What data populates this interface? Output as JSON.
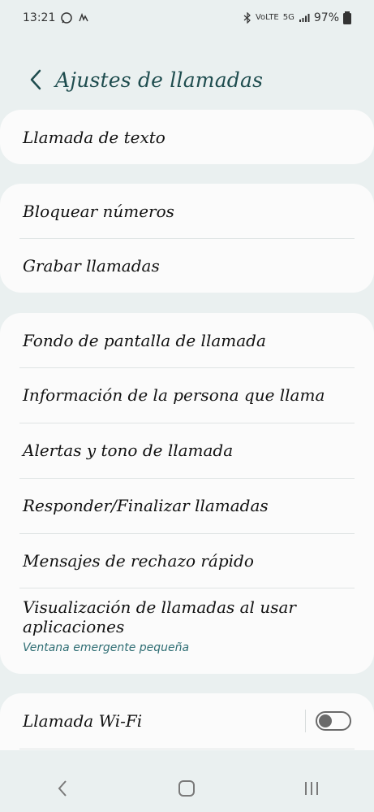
{
  "status_bar": {
    "time": "13:21",
    "battery_text": "97%",
    "network_badge": "5G",
    "volte_badge": "VoLTE",
    "icons": [
      "whatsapp-icon",
      "notification-icon",
      "bluetooth-icon",
      "volte-icon",
      "5g-icon",
      "signal-icon",
      "battery-icon"
    ]
  },
  "header": {
    "title": "Ajustes de llamadas"
  },
  "cards": {
    "card1": {
      "items": [
        {
          "label": "Llamada de texto"
        }
      ]
    },
    "card2": {
      "items": [
        {
          "label": "Bloquear números"
        },
        {
          "label": "Grabar llamadas"
        }
      ]
    },
    "card3": {
      "items": [
        {
          "label": "Fondo de pantalla de llamada"
        },
        {
          "label": "Información de la persona que llama"
        },
        {
          "label": "Alertas y tono de llamada"
        },
        {
          "label": "Responder/Finalizar llamadas"
        },
        {
          "label": "Mensajes de rechazo rápido"
        },
        {
          "label": "Visualización de llamadas al usar aplicaciones",
          "subtitle": "Ventana emergente pequeña"
        }
      ]
    },
    "card4": {
      "items": [
        {
          "label": "Llamada Wi-Fi",
          "toggle_on": false
        }
      ]
    }
  },
  "nav": {
    "icons": [
      "back-nav-icon",
      "home-nav-icon",
      "recents-nav-icon"
    ]
  },
  "colors": {
    "background": "#eaf0f0",
    "card": "#fbfbfb",
    "title_accent": "#1f4d4f",
    "subtitle_accent": "#2e6d73"
  }
}
